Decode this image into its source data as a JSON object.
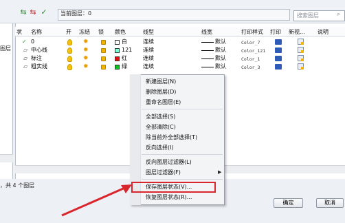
{
  "toolbar": {
    "current_layer_label": "当前图层：0",
    "search_placeholder": "搜索图层",
    "icons": [
      "new-layer-icon",
      "delete-layer-icon",
      "set-current-icon",
      "search-icon"
    ]
  },
  "tree": {
    "visible_text": "图层"
  },
  "grid": {
    "headers": [
      "状",
      "名称",
      "开",
      "冻结",
      "锁",
      "颜色",
      "线型",
      "线宽",
      "打印样式",
      "打印",
      "新视...",
      "说明"
    ],
    "rows": [
      {
        "status": "✓",
        "name": "0",
        "color_name": "白",
        "color": "#ffffff",
        "linetype": "连续",
        "lineweight": "默认",
        "plot_style": "Color_7"
      },
      {
        "status": "▱",
        "name": "中心线",
        "color_name": "121",
        "color": "#7fffd4",
        "linetype": "连续",
        "lineweight": "默认",
        "plot_style": "Color_121"
      },
      {
        "status": "▱",
        "name": "标注",
        "color_name": "红",
        "color": "#e01010",
        "linetype": "连续",
        "lineweight": "默认",
        "plot_style": "Color_1"
      },
      {
        "status": "▱",
        "name": "粗实线",
        "color_name": "绿",
        "color": "#10c020",
        "linetype": "连续",
        "lineweight": "默认",
        "plot_style": "Color_3"
      }
    ]
  },
  "status_bar": {
    "text": "，共 4 个图层"
  },
  "buttons": {
    "ok": "确定",
    "cancel": "取消"
  },
  "context_menu": {
    "items": [
      {
        "label": "新建图层(N)"
      },
      {
        "label": "删除图层(D)"
      },
      {
        "label": "重命名图层(E)"
      },
      {
        "label": "全部选择(S)"
      },
      {
        "label": "全部清除(C)"
      },
      {
        "label": "除当前外全部选择(T)"
      },
      {
        "label": "反向选择(I)"
      },
      {
        "label": "反向图层过滤器(L)"
      },
      {
        "label": "图层过滤器(F)",
        "has_submenu": true
      },
      {
        "label": "保存图层状态(V)...",
        "highlighted": true
      },
      {
        "label": "恢复图层状态(R)..."
      }
    ]
  },
  "colors": {
    "highlight_box": "#d9262c",
    "arrow": "#d9262c"
  }
}
